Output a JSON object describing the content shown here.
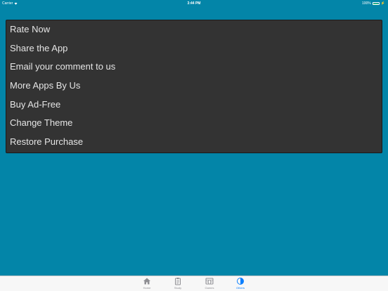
{
  "status_bar": {
    "carrier": "Carrier",
    "time": "3:44 PM",
    "battery_percent": "100%",
    "battery_level": 1.0
  },
  "menu": {
    "items": [
      {
        "label": "Rate Now"
      },
      {
        "label": "Share the App"
      },
      {
        "label": "Email your comment to us"
      },
      {
        "label": "More Apps By Us"
      },
      {
        "label": "Buy Ad-Free"
      },
      {
        "label": "Change Theme"
      },
      {
        "label": "Restore Purchase"
      }
    ]
  },
  "tabs": [
    {
      "label": "Home",
      "icon": "home-icon",
      "active": false
    },
    {
      "label": "Study",
      "icon": "clipboard-icon",
      "active": false
    },
    {
      "label": "Games",
      "icon": "game-icon",
      "active": false
    },
    {
      "label": "Others",
      "icon": "others-icon",
      "active": true
    }
  ],
  "colors": {
    "background": "#0385a8",
    "panel": "#333333",
    "menu_text": "#e5e5e5",
    "tab_active": "#0a7fff",
    "tab_inactive": "#8e8e93"
  }
}
